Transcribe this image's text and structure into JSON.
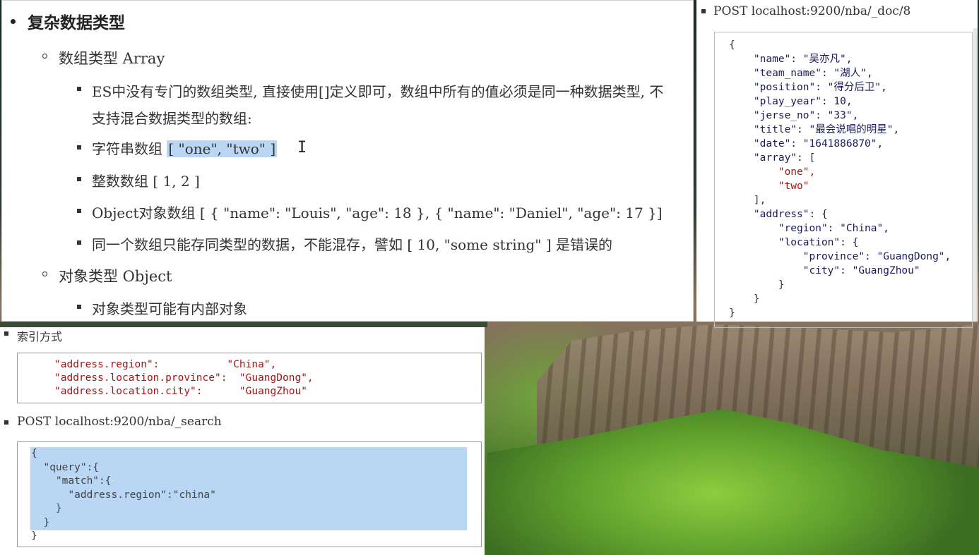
{
  "main_slide": {
    "heading": "复杂数据类型",
    "array_title": "数组类型 Array",
    "array_desc_line1": "ES中没有专门的数组类型, 直接使用[]定义即可，数组中所有的值必须是同一种数据类型, 不",
    "array_desc_line2": "支持混合数据类型的数组:",
    "string_array_label": "字符串数组",
    "string_array_value": "[ \"one\", \"two\" ]",
    "int_array": "整数数组 [ 1, 2 ]",
    "object_array": "Object对象数组 [ { \"name\": \"Louis\", \"age\": 18 }, { \"name\": \"Daniel\", \"age\": 17 }]",
    "same_type_note": "同一个数组只能存同类型的数据，不能混存，譬如 [ 10, \"some string\" ] 是错误的",
    "object_title": "对象类型 Object",
    "object_desc": "对象类型可能有内部对象",
    "ibeam": "I"
  },
  "right_panel": {
    "request": "POST   localhost:9200/nba/_doc/8",
    "code_lines": [
      "{",
      "    \"name\": \"吴亦凡\",",
      "    \"team_name\": \"湖人\",",
      "    \"position\": \"得分后卫\",",
      "    \"play_year\": 10,",
      "    \"jerse_no\": \"33\",",
      "    \"title\": \"最会说唱的明星\",",
      "    \"date\": \"1641886870\",",
      "    \"array\": [",
      "        \"one\",",
      "        \"two\"",
      "    ],",
      "    \"address\": {",
      "        \"region\": \"China\",",
      "        \"location\": {",
      "            \"province\": \"GuangDong\",",
      "            \"city\": \"GuangZhou\"",
      "        }",
      "    }",
      "}"
    ]
  },
  "bottom_panel": {
    "index_title": "索引方式",
    "index_lines": [
      "\"address.region\":           \"China\",",
      "\"address.location.province\":  \"GuangDong\",",
      "\"address.location.city\":      \"GuangZhou\""
    ],
    "request": "POST   localhost:9200/nba/_search",
    "query_lines": [
      "{",
      "  \"query\":{",
      "    \"match\":{",
      "      \"address.region\":\"china\"",
      "    }",
      "  }",
      "}"
    ]
  },
  "colors": {
    "selection": "#b9d7f5",
    "string": "#a31515",
    "key": "#1b1b5a",
    "number": "#1a7a4a"
  }
}
